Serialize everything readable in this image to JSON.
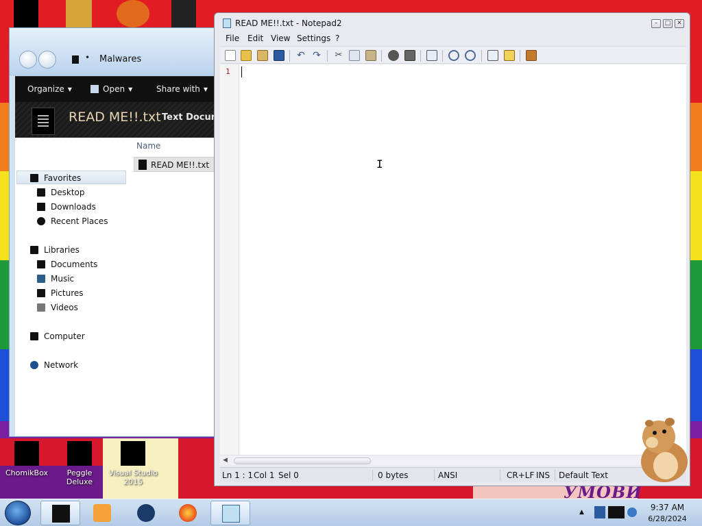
{
  "desktop": {
    "icons": [
      {
        "label": "ChomikBox"
      },
      {
        "label": "Peggle Deluxe"
      },
      {
        "label": "Visual Studio 2015"
      }
    ],
    "wallpaper_text": "УМОВИ",
    "colors": {
      "red": "#e11c22",
      "orange": "#f27d1f",
      "yellow": "#f5e21a",
      "green": "#1f9a3a",
      "blue": "#1e4fd6",
      "purple": "#7b1fa2"
    }
  },
  "explorer": {
    "path": "Malwares",
    "toolbar": {
      "organize": "Organize",
      "open": "Open",
      "share_with": "Share with"
    },
    "preview": {
      "file_name": "READ ME!!.txt",
      "file_type": "Text Docum"
    },
    "nav": {
      "favorites": "Favorites",
      "desktop": "Desktop",
      "downloads": "Downloads",
      "recent_places": "Recent Places",
      "libraries": "Libraries",
      "documents": "Documents",
      "music": "Music",
      "pictures": "Pictures",
      "videos": "Videos",
      "computer": "Computer",
      "network": "Network"
    },
    "column_name": "Name",
    "files": [
      {
        "name": "READ ME!!.txt"
      }
    ]
  },
  "notepad": {
    "title": "READ ME!!.txt - Notepad2",
    "menu": [
      "File",
      "Edit",
      "View",
      "Settings",
      "?"
    ],
    "line_number": "1",
    "content": "",
    "status": {
      "position": "Ln 1 : 1",
      "column": "Col 1",
      "selection": "Sel 0",
      "size": "0 bytes",
      "encoding": "ANSI",
      "line_endings": "CR+LF",
      "insert_mode": "INS",
      "scheme": "Default Text"
    }
  },
  "taskbar": {
    "clock_time": "9:37 AM",
    "clock_date": "6/28/2024"
  }
}
